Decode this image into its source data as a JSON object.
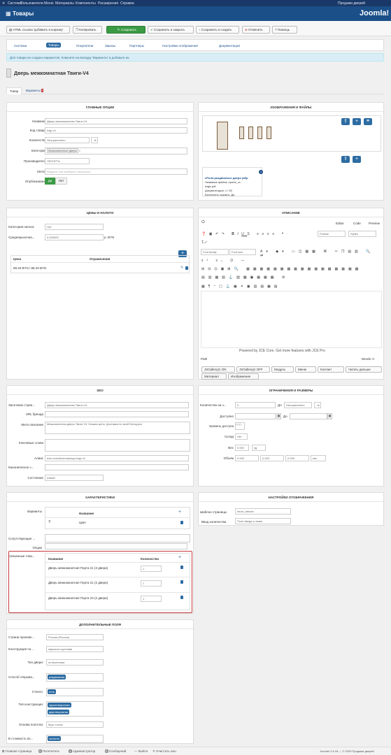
{
  "topnav": {
    "items": [
      "Система",
      "Пользователи",
      "Меню",
      "Материалы",
      "Компоненты",
      "Расширения",
      "Справка"
    ],
    "right": "Продажи дверей"
  },
  "header": {
    "title": "Товары",
    "logo": "Joomla!"
  },
  "toolbar": {
    "html_link": "HTML ссылка 'добавить в корзину'",
    "copy": "Копировать",
    "save": "Сохранить",
    "save_close": "Сохранить и закрыть",
    "save_new": "Сохранить и создать",
    "cancel": "Отменить",
    "help": "Помощь"
  },
  "subnav": [
    "Система",
    "Товары",
    "Покупатели",
    "Заказы",
    "Партнеры",
    "Настройки отображения",
    "Документация"
  ],
  "alert": "Для товара не создано вариантов. Кликните на вкладку 'Варианты' и добавьте их.",
  "page_title": "Дверь межкомнатная Твиги-V4",
  "tabs": {
    "product": "Товар",
    "variants": "Варианты",
    "variants_badge": "!"
  },
  "main_options": {
    "header": "ГЛАВНЫЕ ОПЦИИ",
    "name_label": "Название",
    "name_value": "Дверь межкомнатная Твиги-V4",
    "code_label": "Код товара",
    "code_value": "tvigi-v4",
    "qty_label": "Количество",
    "qty_value": "Неограничено",
    "cat_label": "Категории",
    "cat_value": "Межкомнатные двери",
    "mfr_label": "Производитель",
    "mfr_value": "ЛЕПОРТА",
    "tags_label": "Метки",
    "tags_placeholder": "Введите или выберите несколько",
    "pub_label": "Опубликовано",
    "pub_yes": "Да",
    "pub_no": "Нет"
  },
  "images": {
    "header": "ИЗОБРАЖЕНИЯ И ФАЙЛЫ",
    "file_title": "ePorta раздвижные двери (вбр",
    "file_line1": "Название файла: eporte_ra",
    "file_line2": "tvigiv.pdf",
    "file_line3": "Документация: 1 / 50",
    "file_line4": "Бесплатно скачать: Да"
  },
  "prices": {
    "header": "ЦЕНЫ И НАЛОГИ",
    "tax_label": "Категория налога",
    "tax_value": "Нет",
    "avg_label": "Среднерыночна...",
    "avg_value": "0,000000",
    "avg_unit": "р. BYN",
    "col_price": "Цена",
    "col_limit": "Ограничения",
    "price_row": "88.40 BYN / 88.40 BYN"
  },
  "description": {
    "header": "ОПИСАНИЕ",
    "tab_editor": "Editor",
    "tab_code": "Code",
    "tab_preview": "Preview",
    "format": "Format",
    "styles": "Styles",
    "font_family": "Font family",
    "font_size": "Font size",
    "powered": "Powered by JCE Core. Get more features with JCE Pro",
    "path": "Path",
    "words": "Words: 0",
    "btn_on": "JSGallery(n ON",
    "btn_off": "JSGallery(n OFF",
    "btn_module": "Модуль",
    "btn_menu": "Меню",
    "btn_contact": "Контакт",
    "btn_read": "Читать дальше",
    "btn_material": "Материал",
    "btn_image": "Изображение"
  },
  "seo": {
    "header": "SEO",
    "title_label": "Заголовок стран...",
    "title_value": "Дверь межкомнатная Твиги-V4",
    "brand_label": "URL бренда",
    "meta_label": "Мета описание",
    "meta_value": "Межкомнатная дверь Твиги V4. Низкая цена. Доставка по всей Беларуси",
    "keys_label": "Ключевые слова",
    "alias_label": "Алиас",
    "alias_value": "dver-mezhkomnatnaya-tvigi-v4",
    "canon_label": "Каноническое с...",
    "state_label": "Состояние",
    "state_value": "новый"
  },
  "limits": {
    "header": "ОГРАНИЧЕНИЯ И РАЗМЕРЫ",
    "qty_label": "Количество на з...",
    "qty_value": "0",
    "to": "До",
    "unlimited": "Неограничено",
    "avail_label": "Доступно",
    "access_label": "Уровень доступа",
    "stock_label": "Склад",
    "stock_value": "Нет",
    "weight_label": "Вес",
    "weight_value": "0.000",
    "weight_unit": "kg",
    "vol_label": "Объем",
    "vol_1": "0.000",
    "vol_2": "0.000",
    "vol_3": "0.000",
    "vol_unit": "мм"
  },
  "characteristics": {
    "header": "ХАРАКТЕРИСТИКИ",
    "variants_label": "Варианты",
    "col_name": "Название",
    "row_color": "Цвет",
    "related_label": "Сопутствующие ...",
    "options_label": "Опции",
    "linked_label": "Связанные това...",
    "col_lname": "Название",
    "col_qty": "Количество",
    "linked": [
      {
        "name": "Дверь межкомнатная Порта 21 (3 двери)",
        "qty": "1"
      },
      {
        "name": "Дверь межкомнатная Порта 21 (2 двери)",
        "qty": "1"
      },
      {
        "name": "Дверь межкомнатная Порта 23 (2 двери)",
        "qty": "1"
      }
    ]
  },
  "display": {
    "header": "НАСТРОЙКИ ОТОБРАЖЕНИЯ",
    "tpl_label": "Шаблон страницы",
    "tpl_value": "show_tabular",
    "qty_label": "Ввод количества",
    "qty_value": "Поле ввода и знаки"
  },
  "extra": {
    "header": "ДОПОЛНИТЕЛЬНЫЕ ПОЛЯ",
    "country_label": "Страна произво...",
    "country_value": "Россия (Россия)",
    "constr_label": "Конструкция по...",
    "constr_value": "каркасно-щитовая",
    "type_label": "Тип двери:",
    "type_value": "остекленная",
    "open_label": "Способ открыва...",
    "open_chip": "раздвижная",
    "glass_label": "Стекло:",
    "glass_chip": "есть",
    "ctype_label": "Тип конструкции:",
    "ctype_chip1": "одностворчатая",
    "ctype_chip2": "двустворчатая",
    "base_label": "Основа полотна:",
    "base_value": "брус сосны",
    "incl_label": "В стоимость вх...",
    "incl_chip": "полотно"
  },
  "footer": {
    "site": "Главная страница",
    "visitors": "0",
    "visitors_label": "Посетитель",
    "admins": "1",
    "admins_label": "Администратор",
    "messages": "0",
    "messages_label": "Сообщений",
    "logout": "Выйти",
    "cache": "Очистить кэш",
    "version": "Joomla! 3.9.18 — © 2020 Продажи дверей"
  },
  "colors": {
    "brand": "#1b4f88",
    "accent": "#2d6ca2",
    "green": "#3b9a44",
    "highlight": "#c43b3b"
  }
}
